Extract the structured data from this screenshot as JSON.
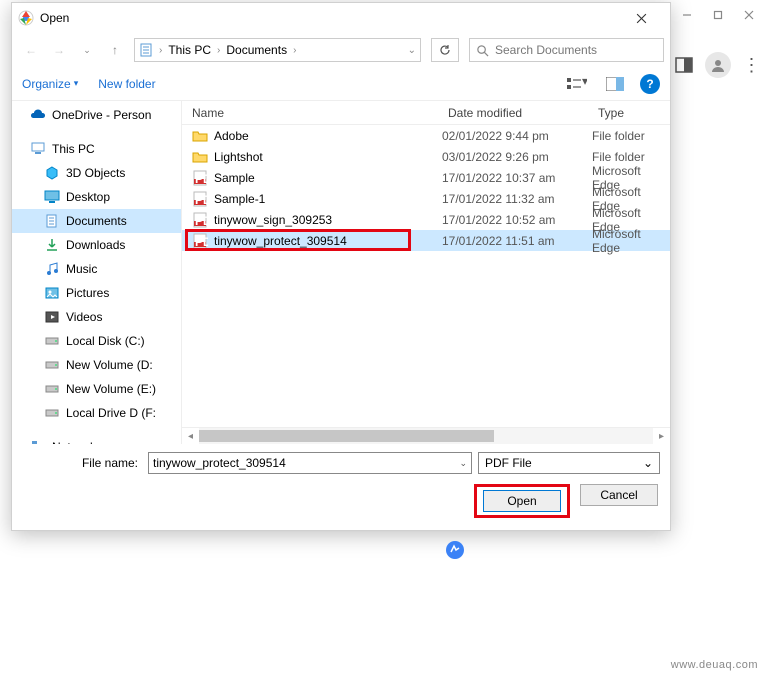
{
  "outer": {
    "panel_icon": "panel-icon",
    "avatar": "avatar-icon",
    "menu": "kebab-menu"
  },
  "dialog": {
    "title": "Open",
    "nav": {
      "breadcrumb": [
        "This PC",
        "Documents"
      ],
      "search_placeholder": "Search Documents"
    },
    "toolbar": {
      "organize": "Organize",
      "new_folder": "New folder"
    },
    "sidebar": [
      {
        "label": "OneDrive - Person",
        "icon": "onedrive",
        "level": 0
      },
      {
        "label": "This PC",
        "icon": "this-pc",
        "level": 0
      },
      {
        "label": "3D Objects",
        "icon": "3d",
        "level": 1
      },
      {
        "label": "Desktop",
        "icon": "desktop",
        "level": 1
      },
      {
        "label": "Documents",
        "icon": "documents",
        "level": 1,
        "selected": true
      },
      {
        "label": "Downloads",
        "icon": "downloads",
        "level": 1
      },
      {
        "label": "Music",
        "icon": "music",
        "level": 1
      },
      {
        "label": "Pictures",
        "icon": "pictures",
        "level": 1
      },
      {
        "label": "Videos",
        "icon": "videos",
        "level": 1
      },
      {
        "label": "Local Disk (C:)",
        "icon": "drive",
        "level": 1
      },
      {
        "label": "New Volume (D:",
        "icon": "drive",
        "level": 1
      },
      {
        "label": "New Volume (E:)",
        "icon": "drive",
        "level": 1
      },
      {
        "label": "Local Drive D (F:",
        "icon": "drive",
        "level": 1
      },
      {
        "label": "Network",
        "icon": "network",
        "level": 0
      }
    ],
    "columns": {
      "name": "Name",
      "date": "Date modified",
      "type": "Type"
    },
    "files": [
      {
        "name": "Adobe",
        "date": "02/01/2022 9:44 pm",
        "type": "File folder",
        "icon": "folder"
      },
      {
        "name": "Lightshot",
        "date": "03/01/2022 9:26 pm",
        "type": "File folder",
        "icon": "folder"
      },
      {
        "name": "Sample",
        "date": "17/01/2022 10:37 am",
        "type": "Microsoft Edge",
        "icon": "pdf"
      },
      {
        "name": "Sample-1",
        "date": "17/01/2022 11:32 am",
        "type": "Microsoft Edge",
        "icon": "pdf"
      },
      {
        "name": "tinywow_sign_309253",
        "date": "17/01/2022 10:52 am",
        "type": "Microsoft Edge",
        "icon": "pdf"
      },
      {
        "name": "tinywow_protect_309514",
        "date": "17/01/2022 11:51 am",
        "type": "Microsoft Edge",
        "icon": "pdf",
        "selected": true,
        "highlighted": true
      }
    ],
    "filename_label": "File name:",
    "filename_value": "tinywow_protect_309514",
    "filetype_value": "PDF File",
    "open_btn": "Open",
    "cancel_btn": "Cancel"
  },
  "watermark": "www.deuaq.com"
}
